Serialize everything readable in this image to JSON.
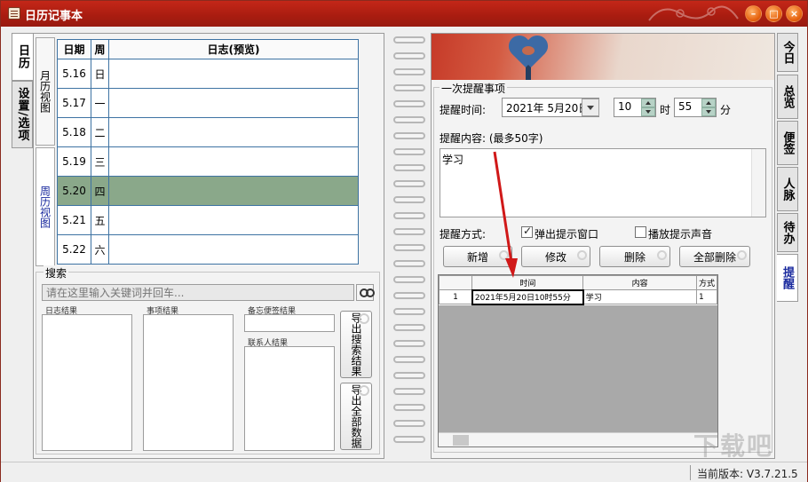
{
  "window": {
    "title": "日历记事本",
    "minimize_label": "–",
    "maximize_label": "□",
    "close_label": "×"
  },
  "left_tabs": [
    {
      "label": "日历",
      "active": true
    },
    {
      "label": "设置/选项",
      "active": false
    }
  ],
  "view_tabs": [
    {
      "label": "月历视图",
      "selected": false
    },
    {
      "label": "周历视图",
      "selected": true
    }
  ],
  "week_table": {
    "headers": [
      "日期",
      "周",
      "日志(预览)"
    ],
    "rows": [
      {
        "date": "5.16",
        "weekday": "日",
        "preview": "",
        "selected": false
      },
      {
        "date": "5.17",
        "weekday": "一",
        "preview": "",
        "selected": false
      },
      {
        "date": "5.18",
        "weekday": "二",
        "preview": "",
        "selected": false
      },
      {
        "date": "5.19",
        "weekday": "三",
        "preview": "",
        "selected": false
      },
      {
        "date": "5.20",
        "weekday": "四",
        "preview": "",
        "selected": true
      },
      {
        "date": "5.21",
        "weekday": "五",
        "preview": "",
        "selected": false
      },
      {
        "date": "5.22",
        "weekday": "六",
        "preview": "",
        "selected": false
      }
    ]
  },
  "search": {
    "legend": "搜索",
    "placeholder": "请在这里输入关键词并回车...",
    "results": {
      "journal": "日志结果",
      "items": "事项结果",
      "memo": "备忘便签结果",
      "contacts": "联系人结果"
    },
    "export_search_label": "导出搜索结果",
    "export_all_label": "导出全部数据"
  },
  "reminder": {
    "legend": "一次提醒事项",
    "time_label": "提醒时间:",
    "date_value": "2021年 5月20日",
    "hour_value": "10",
    "hour_unit": "时",
    "minute_value": "55",
    "minute_unit": "分",
    "content_label": "提醒内容: (最多50字)",
    "content_value": "学习",
    "method_label": "提醒方式:",
    "popup_label": "弹出提示窗口",
    "popup_checked": true,
    "sound_label": "播放提示声音",
    "sound_checked": false,
    "buttons": {
      "add": "新增",
      "modify": "修改",
      "delete": "删除",
      "delete_all": "全部删除"
    },
    "grid": {
      "headers": [
        "",
        "时间",
        "内容",
        "方式"
      ],
      "rows": [
        {
          "index": "1",
          "time": "2021年5月20日10时55分",
          "content": "学习",
          "method": "1"
        }
      ]
    }
  },
  "right_tabs": [
    {
      "label": "今日",
      "active": false
    },
    {
      "label": "总览",
      "active": false
    },
    {
      "label": "便签",
      "active": false
    },
    {
      "label": "人脉",
      "active": false
    },
    {
      "label": "待办",
      "active": false
    },
    {
      "label": "提醒",
      "active": true
    }
  ],
  "status": {
    "version_text": "当前版本: V3.7.21.5"
  },
  "watermark": "下载吧",
  "colors": {
    "titlebar": "#b02010",
    "selected_row": "#8aa88a",
    "arrow": "#d01818"
  }
}
